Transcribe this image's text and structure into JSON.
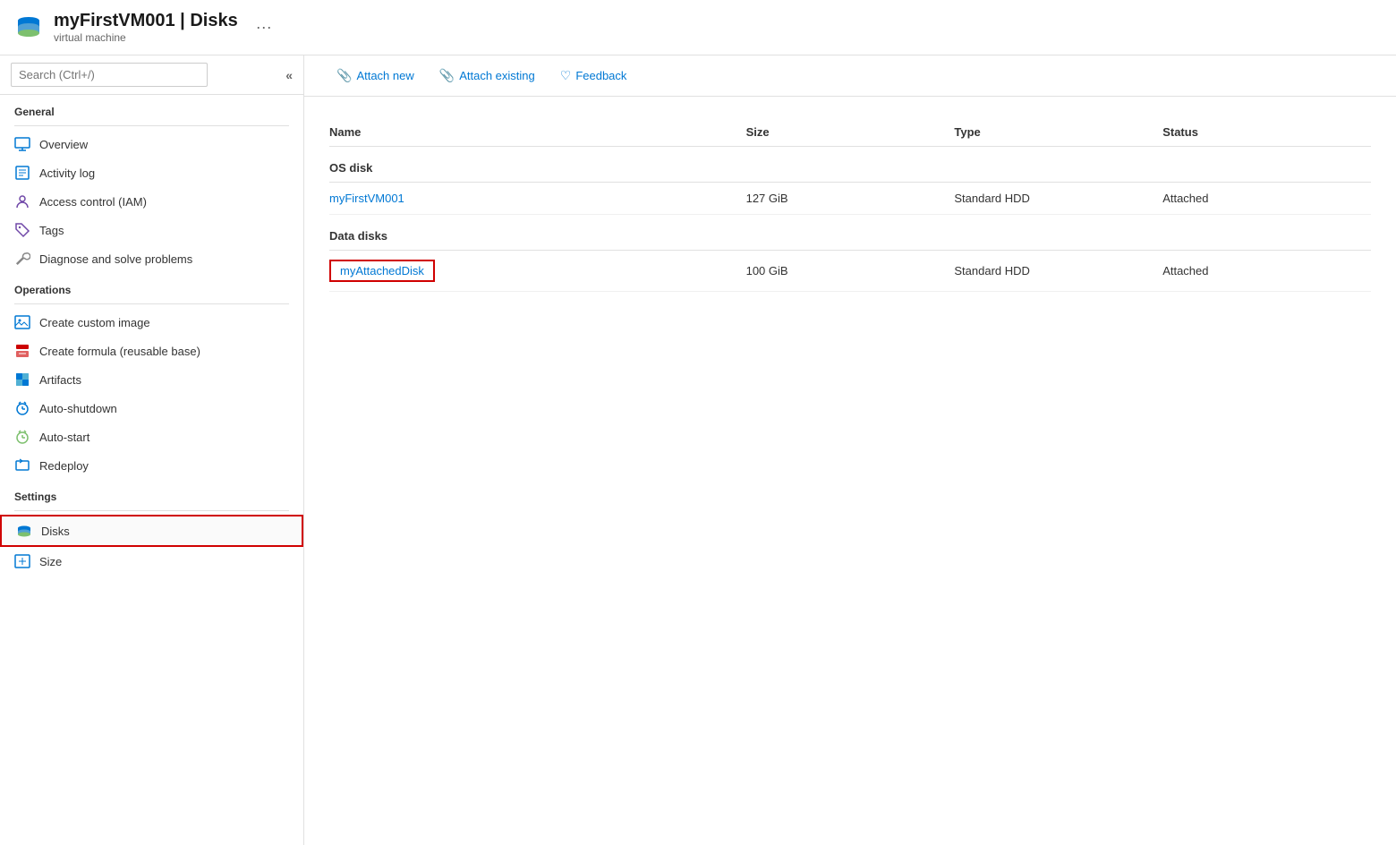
{
  "header": {
    "title": "myFirstVM001 | Disks",
    "subtitle": "virtual machine",
    "ellipsis": "···"
  },
  "sidebar": {
    "search_placeholder": "Search (Ctrl+/)",
    "collapse_label": "«",
    "sections": [
      {
        "label": "General",
        "items": [
          {
            "id": "overview",
            "label": "Overview",
            "icon": "monitor"
          },
          {
            "id": "activity-log",
            "label": "Activity log",
            "icon": "list"
          },
          {
            "id": "access-control",
            "label": "Access control (IAM)",
            "icon": "person"
          },
          {
            "id": "tags",
            "label": "Tags",
            "icon": "tag"
          },
          {
            "id": "diagnose",
            "label": "Diagnose and solve problems",
            "icon": "wrench"
          }
        ]
      },
      {
        "label": "Operations",
        "items": [
          {
            "id": "create-image",
            "label": "Create custom image",
            "icon": "image"
          },
          {
            "id": "create-formula",
            "label": "Create formula (reusable base)",
            "icon": "formula"
          },
          {
            "id": "artifacts",
            "label": "Artifacts",
            "icon": "artifacts"
          },
          {
            "id": "auto-shutdown",
            "label": "Auto-shutdown",
            "icon": "clock"
          },
          {
            "id": "auto-start",
            "label": "Auto-start",
            "icon": "clock2"
          },
          {
            "id": "redeploy",
            "label": "Redeploy",
            "icon": "redeploy"
          }
        ]
      },
      {
        "label": "Settings",
        "items": [
          {
            "id": "disks",
            "label": "Disks",
            "icon": "disk",
            "active": true
          },
          {
            "id": "size",
            "label": "Size",
            "icon": "size"
          }
        ]
      }
    ]
  },
  "toolbar": {
    "attach_new_label": "Attach new",
    "attach_existing_label": "Attach existing",
    "feedback_label": "Feedback"
  },
  "table": {
    "columns": [
      "Name",
      "Size",
      "Type",
      "Status"
    ],
    "os_disk_section": "OS disk",
    "data_disk_section": "Data disks",
    "os_disk": {
      "name": "myFirstVM001",
      "size": "127 GiB",
      "type": "Standard HDD",
      "status": "Attached"
    },
    "data_disks": [
      {
        "name": "myAttachedDisk",
        "size": "100 GiB",
        "type": "Standard HDD",
        "status": "Attached",
        "highlighted": true
      }
    ]
  }
}
